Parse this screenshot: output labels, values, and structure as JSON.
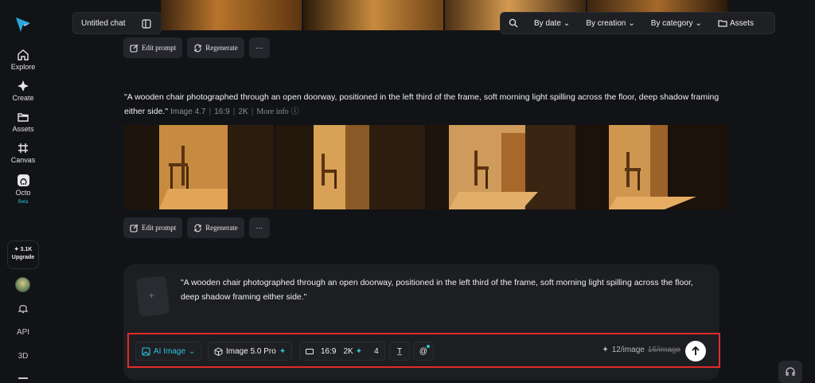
{
  "sidebar": {
    "items": [
      {
        "label": "Explore",
        "icon": "home-icon"
      },
      {
        "label": "Create",
        "icon": "sparkle-icon"
      },
      {
        "label": "Assets",
        "icon": "folder-icon"
      },
      {
        "label": "Canvas",
        "icon": "canvas-icon"
      },
      {
        "label": "Octo",
        "icon": "octo-icon",
        "badge": "Beta"
      }
    ],
    "upgrade": {
      "credits": "3.1K",
      "label": "Upgrade"
    },
    "extra": [
      "API",
      "3D"
    ]
  },
  "header": {
    "chat_title": "Untitled chat",
    "filters": [
      "By date",
      "By creation",
      "By category"
    ],
    "assets_label": "Assets"
  },
  "actions": {
    "edit_label": "Edit prompt",
    "regen_label": "Regenerate"
  },
  "generation": {
    "prompt": "\"A wooden chair photographed through an open doorway, positioned in the left third of the frame, soft morning light spilling across the floor, deep shadow framing either side.\"",
    "model": "Image 4.7",
    "ratio": "16:9",
    "resolution": "2K",
    "more_info": "More info"
  },
  "composer": {
    "prompt": "\"A wooden chair photographed through an open doorway, positioned in the left third of the frame, soft morning light spilling across the floor, deep shadow framing either side.\"",
    "mode": "AI Image",
    "model": "Image 5.0 Pro",
    "ratio": "16:9",
    "resolution": "2K",
    "count": "4",
    "cost": "12/image",
    "old_cost": "16/image"
  },
  "colors": {
    "accent": "#29c3d8",
    "highlight": "#e02b2b"
  }
}
